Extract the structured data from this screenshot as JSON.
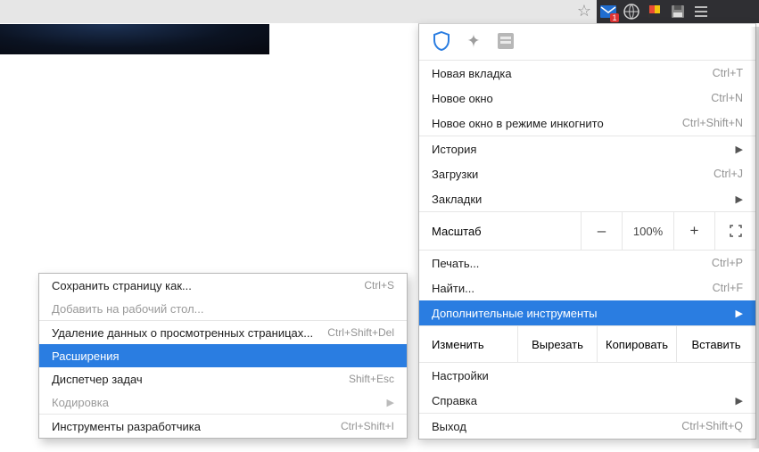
{
  "toolbar": {
    "star": "☆",
    "ext_icons": [
      "mail-icon",
      "envelope-icon",
      "globe-icon",
      "flag-icon",
      "disk-icon",
      "menu-icon"
    ],
    "badge": "1"
  },
  "app_row": {
    "shield_color": "#2a7de1"
  },
  "main_menu": {
    "new_tab": {
      "label": "Новая вкладка",
      "shortcut": "Ctrl+T"
    },
    "new_window": {
      "label": "Новое окно",
      "shortcut": "Ctrl+N"
    },
    "incognito": {
      "label": "Новое окно в режиме инкогнито",
      "shortcut": "Ctrl+Shift+N"
    },
    "history": {
      "label": "История"
    },
    "downloads": {
      "label": "Загрузки",
      "shortcut": "Ctrl+J"
    },
    "bookmarks": {
      "label": "Закладки"
    },
    "zoom": {
      "label": "Масштаб",
      "value": "100%",
      "minus": "–",
      "plus": "+"
    },
    "print": {
      "label": "Печать...",
      "shortcut": "Ctrl+P"
    },
    "find": {
      "label": "Найти...",
      "shortcut": "Ctrl+F"
    },
    "more_tools": {
      "label": "Дополнительные инструменты"
    },
    "edit": {
      "label": "Изменить",
      "cut": "Вырезать",
      "copy": "Копировать",
      "paste": "Вставить"
    },
    "settings": {
      "label": "Настройки"
    },
    "help": {
      "label": "Справка"
    },
    "exit": {
      "label": "Выход",
      "shortcut": "Ctrl+Shift+Q"
    }
  },
  "sub_menu": {
    "save_as": {
      "label": "Сохранить страницу как...",
      "shortcut": "Ctrl+S"
    },
    "add_desk": {
      "label": "Добавить на рабочий стол..."
    },
    "clear": {
      "label": "Удаление данных о просмотренных страницах...",
      "shortcut": "Ctrl+Shift+Del"
    },
    "extensions": {
      "label": "Расширения"
    },
    "taskmgr": {
      "label": "Диспетчер задач",
      "shortcut": "Shift+Esc"
    },
    "encoding": {
      "label": "Кодировка"
    },
    "devtools": {
      "label": "Инструменты разработчика",
      "shortcut": "Ctrl+Shift+I"
    }
  }
}
